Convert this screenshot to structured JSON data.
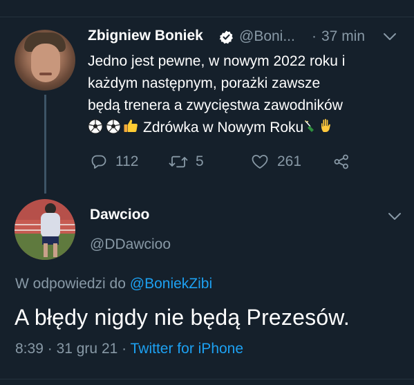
{
  "colors": {
    "background": "#15202b",
    "primary_text": "#ffffff",
    "secondary_text": "#8899a6",
    "accent": "#1da1f2",
    "thread_line": "#3d5466"
  },
  "parent_tweet": {
    "author_name": "Zbigniew Boniek",
    "verified": true,
    "handle": "@Boni...",
    "separator": "·",
    "time_ago": "37 min",
    "text_lines": [
      "Jedno jest pewne, w nowym 2022 roku i",
      "każdym następnym, porażki zawsze",
      "będą trenera  a zwycięstwa zawodników",
      "Zdrówka w Nowym Roku"
    ],
    "emoji": [
      "soccer-ball",
      "soccer-ball",
      "thumbs-up",
      "champagne",
      "raised-hand"
    ],
    "actions": {
      "reply_count": "112",
      "retweet_count": "5",
      "like_count": "261"
    }
  },
  "reply_tweet": {
    "author_name": "Dawcioo",
    "handle": "@DDawcioo",
    "reply_prefix": "W odpowiedzi do",
    "reply_mention": "@BoniekZibi",
    "text": "A błędy nigdy nie będą Prezesów.",
    "time": "8:39",
    "date": "31 gru 21",
    "separator": "·",
    "source": "Twitter for iPhone"
  }
}
